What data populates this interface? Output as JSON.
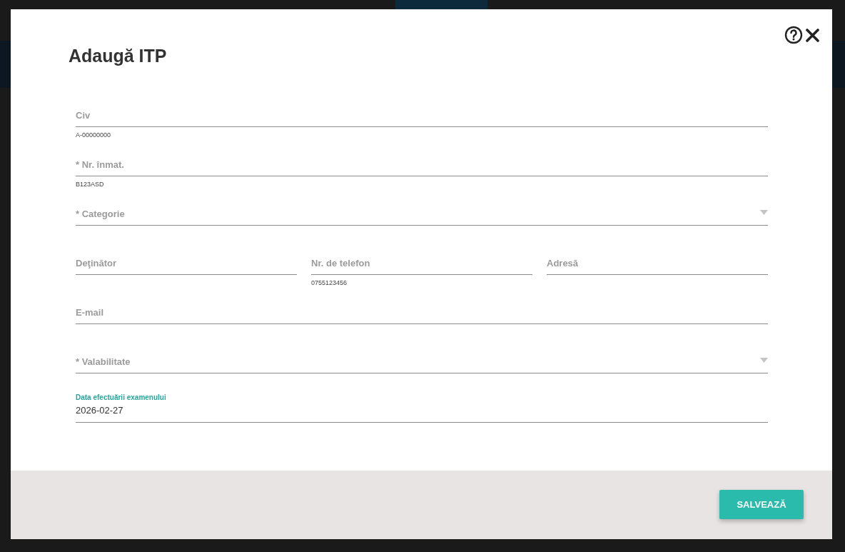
{
  "dialog": {
    "title": "Adaugă ITP",
    "rows": [
      [
        {
          "kind": "text",
          "label": "Civ",
          "hint": "A-00000000"
        }
      ],
      [
        {
          "kind": "text",
          "label": "* Nr. înmat.",
          "hint": "B123ASD"
        }
      ],
      [
        {
          "kind": "select",
          "label": "* Categorie"
        }
      ],
      [
        {
          "kind": "text",
          "label": "Deţinător"
        },
        {
          "kind": "text",
          "label": "Nr. de telefon",
          "hint": "0755123456"
        },
        {
          "kind": "text",
          "label": "Adresă"
        }
      ],
      [
        {
          "kind": "text",
          "label": "E-mail"
        }
      ],
      [
        {
          "kind": "select",
          "label": "* Valabilitate"
        }
      ],
      [
        {
          "kind": "date",
          "label": "Data efectuării examenului",
          "value": "2026-02-27"
        }
      ]
    ],
    "save_button": "SALVEAZĂ"
  }
}
